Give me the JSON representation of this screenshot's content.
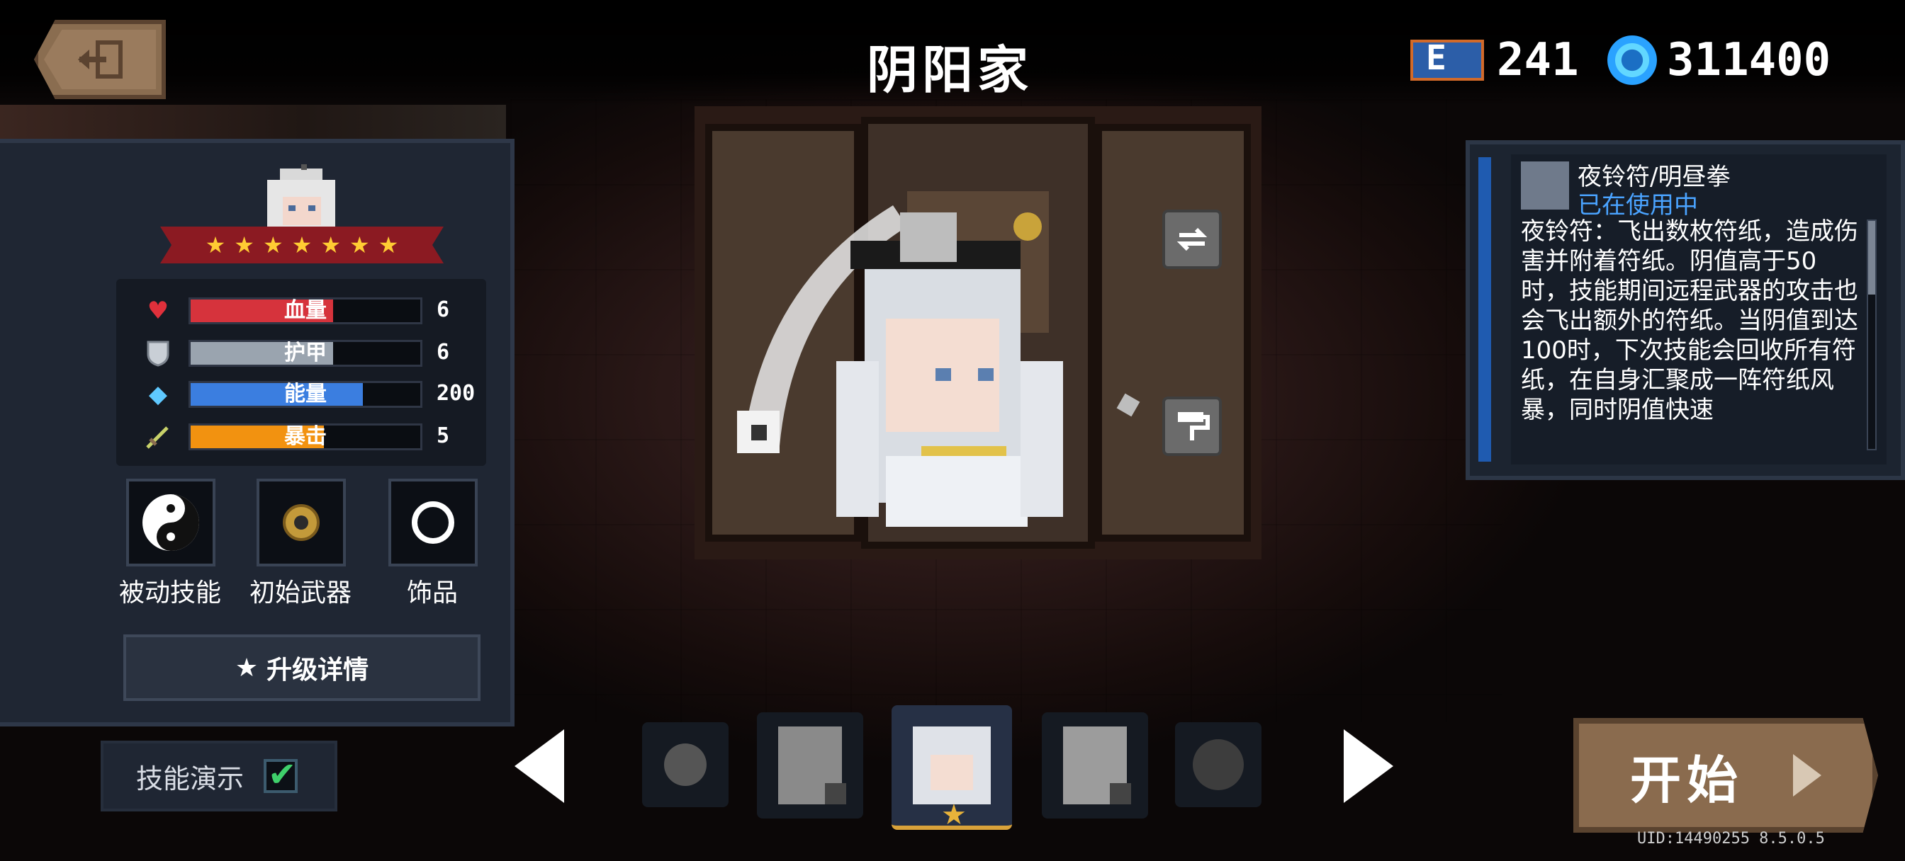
{
  "header": {
    "title": "阴阳家",
    "gems": "241",
    "coins": "311400"
  },
  "stats": [
    {
      "label": "血量",
      "value": "6",
      "icon": "heart-icon",
      "fill": 0.62,
      "color": "#d6333c"
    },
    {
      "label": "护甲",
      "value": "6",
      "icon": "shield-icon",
      "fill": 0.62,
      "color": "#9aa4af"
    },
    {
      "label": "能量",
      "value": "200",
      "icon": "crystal-icon",
      "fill": 0.75,
      "color": "#3b7ee0"
    },
    {
      "label": "暴击",
      "value": "5",
      "icon": "sword-icon",
      "fill": 0.58,
      "color": "#f29210"
    }
  ],
  "rank_stars": 7,
  "slots": {
    "passive_label": "被动技能",
    "weapon_label": "初始武器",
    "accessory_label": "饰品"
  },
  "upgrade": {
    "label": "升级详情"
  },
  "skill_demo": {
    "label": "技能演示"
  },
  "skill": {
    "name": "夜铃符/明昼拳",
    "status": "已在使用中",
    "description": "夜铃符：飞出数枚符纸，造成伤害并附着符纸。阴值高于50时，技能期间远程武器的攻击也会飞出额外的符纸。当阴值到达100时，下次技能会回收所有符纸，在自身汇聚成一阵符纸风暴，同时阴值快速"
  },
  "start": {
    "label": "开始"
  },
  "uid": "UID:14490255 8.5.0.5",
  "colors": {
    "accent_gold": "#d9a23a",
    "status_blue": "#4aa3ff",
    "panel": "#1f2633"
  }
}
